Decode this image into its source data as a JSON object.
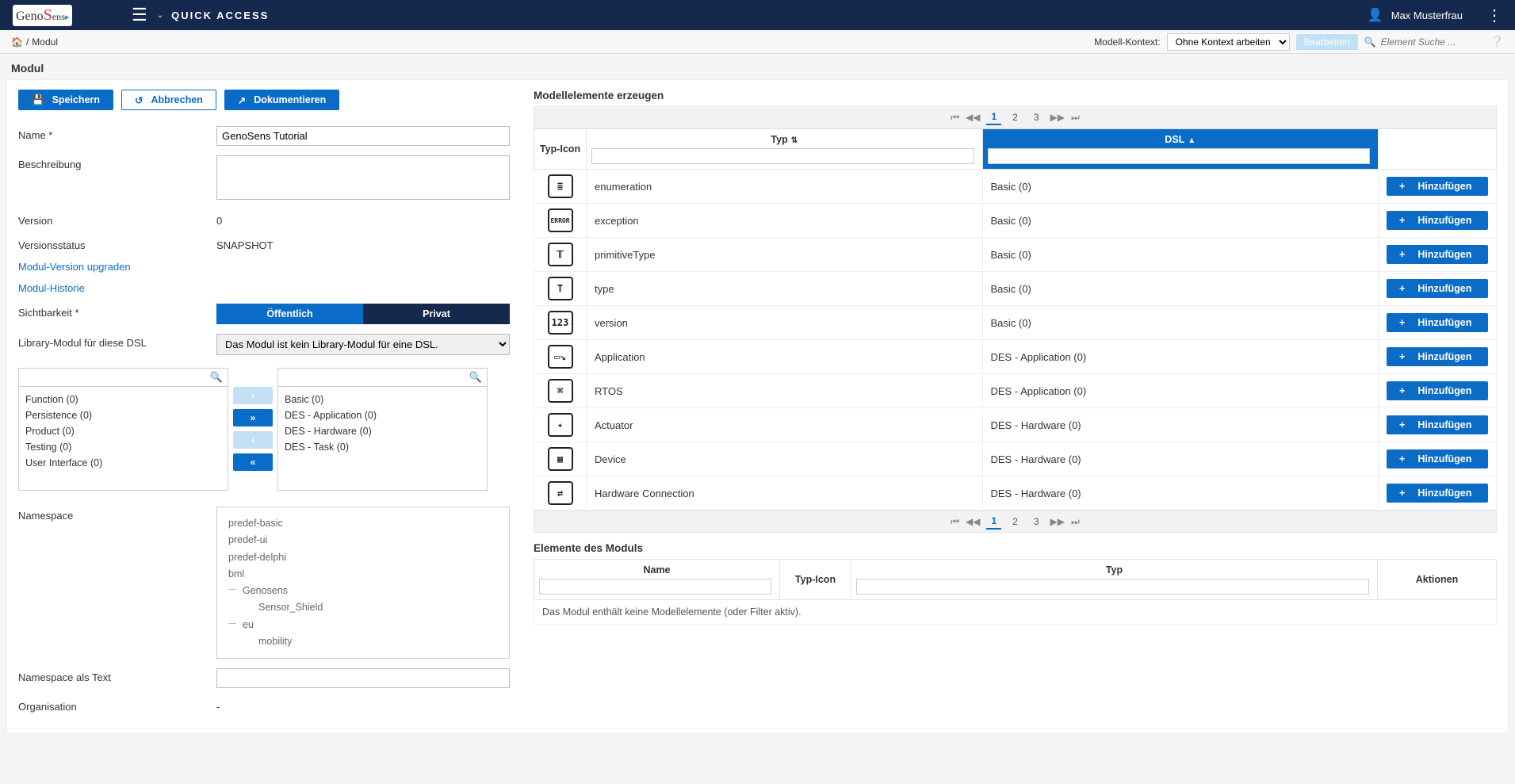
{
  "topbar": {
    "quick_access": "QUICK ACCESS",
    "user_name": "Max Musterfrau"
  },
  "secbar": {
    "breadcrumb_module": "Modul",
    "context_label": "Modell-Kontext:",
    "context_value": "Ohne Kontext arbeiten",
    "edit_button": "Bearbeiten",
    "search_placeholder": "Element Suche ..."
  },
  "page_title": "Modul",
  "buttons": {
    "save": "Speichern",
    "cancel": "Abbrechen",
    "document": "Dokumentieren"
  },
  "form": {
    "name_label": "Name",
    "name_value": "GenoSens Tutorial",
    "desc_label": "Beschreibung",
    "desc_value": "",
    "version_label": "Version",
    "version_value": "0",
    "vstatus_label": "Versionsstatus",
    "vstatus_value": "SNAPSHOT",
    "upgrade_link": "Modul-Version upgraden",
    "history_link": "Modul-Historie",
    "visibility_label": "Sichtbarkeit",
    "visibility_public": "Öffentlich",
    "visibility_private": "Privat",
    "library_label": "Library-Modul für diese DSL",
    "library_value": "Das Modul ist kein Library-Modul für eine DSL.",
    "left_list": {
      "items": [
        "Function (0)",
        "Persistence (0)",
        "Product (0)",
        "Testing (0)",
        "User Interface (0)"
      ]
    },
    "right_list": {
      "items": [
        "Basic (0)",
        "DES - Application (0)",
        "DES - Hardware (0)",
        "DES - Task (0)"
      ]
    },
    "namespace_label": "Namespace",
    "namespace_tree": {
      "items": [
        "predef-basic",
        "predef-ui",
        "predef-delphi",
        "bml"
      ],
      "exp1": "Genosens",
      "exp1_child": "Sensor_Shield",
      "exp2": "eu",
      "exp2_child": "mobility"
    },
    "ns_text_label": "Namespace als Text",
    "ns_text_value": "",
    "org_label": "Organisation",
    "org_value": "-"
  },
  "right": {
    "create_title": "Modellelemente erzeugen",
    "cols": {
      "icon": "Typ-Icon",
      "type": "Typ",
      "dsl": "DSL"
    },
    "add_label": "Hinzufügen",
    "rows": [
      {
        "icon": "≣",
        "type": "enumeration",
        "dsl": "Basic (0)"
      },
      {
        "icon": "ERROR",
        "type": "exception",
        "dsl": "Basic (0)"
      },
      {
        "icon": "𝕋",
        "type": "primitiveType",
        "dsl": "Basic (0)"
      },
      {
        "icon": "T",
        "type": "type",
        "dsl": "Basic (0)"
      },
      {
        "icon": "123",
        "type": "version",
        "dsl": "Basic (0)"
      },
      {
        "icon": "▭↘",
        "type": "Application",
        "dsl": "DES - Application (0)"
      },
      {
        "icon": "⌘",
        "type": "RTOS",
        "dsl": "DES - Application (0)"
      },
      {
        "icon": "✦",
        "type": "Actuator",
        "dsl": "DES - Hardware (0)"
      },
      {
        "icon": "▦",
        "type": "Device",
        "dsl": "DES - Hardware (0)"
      },
      {
        "icon": "⇄",
        "type": "Hardware Connection",
        "dsl": "DES - Hardware (0)"
      }
    ],
    "pages": [
      "1",
      "2",
      "3"
    ],
    "module_elems_title": "Elemente des Moduls",
    "me_cols": {
      "name": "Name",
      "icon": "Typ-Icon",
      "type": "Typ",
      "actions": "Aktionen"
    },
    "empty_msg": "Das Modul enthält keine Modellelemente (oder Filter aktiv)."
  }
}
